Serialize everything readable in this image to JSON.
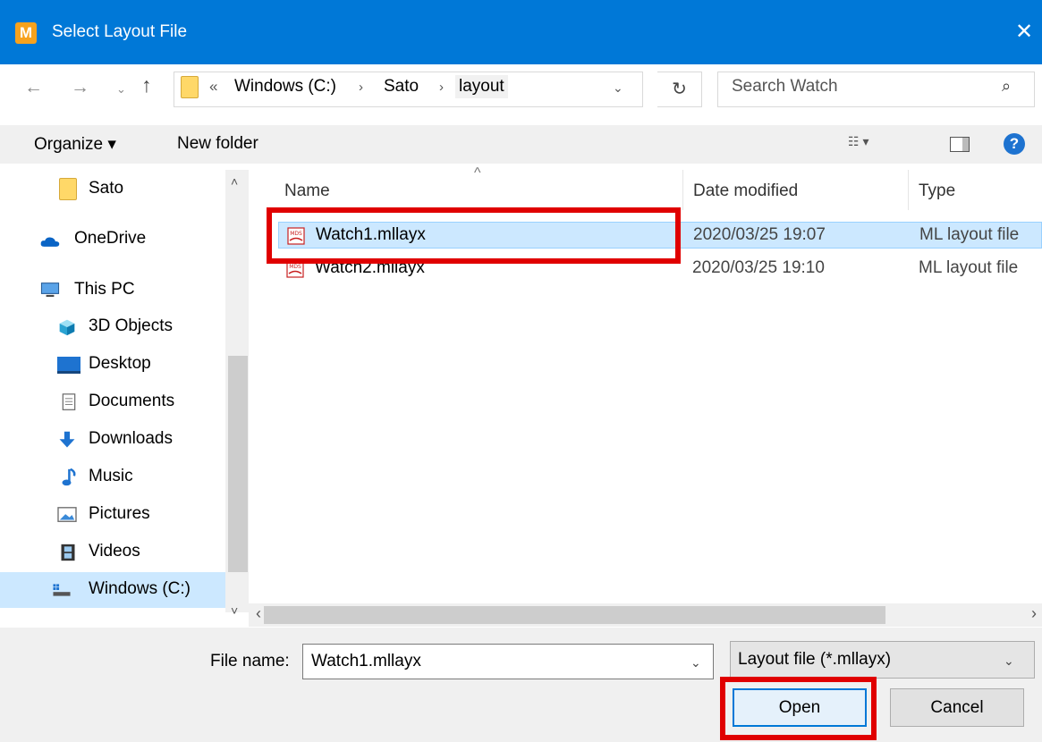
{
  "titlebar": {
    "app_icon": "M",
    "title": "Select Layout File",
    "close": "✕"
  },
  "nav_buttons": {
    "back": "←",
    "forward": "→",
    "recent": "⌄",
    "up": "↑"
  },
  "address": {
    "more": "«",
    "crumbs": [
      "Windows (C:)",
      "Sato",
      "layout"
    ],
    "separator": "›",
    "dropdown": "⌄",
    "refresh": "↻"
  },
  "search": {
    "placeholder": "Search Watch",
    "icon": "⌕"
  },
  "toolbar": {
    "organize": "Organize ▾",
    "new_folder": "New folder",
    "view": "☷ ▾",
    "help": "?"
  },
  "nav_pane": {
    "items": [
      {
        "label": "Sato",
        "icon": "folder-icon"
      },
      {
        "label": "OneDrive",
        "icon": "cloud-icon"
      },
      {
        "label": "This PC",
        "icon": "pc-icon"
      },
      {
        "label": "3D Objects",
        "icon": "cube-icon"
      },
      {
        "label": "Desktop",
        "icon": "desktop-icon"
      },
      {
        "label": "Documents",
        "icon": "document-icon"
      },
      {
        "label": "Downloads",
        "icon": "download-arrow-icon"
      },
      {
        "label": "Music",
        "icon": "music-note-icon"
      },
      {
        "label": "Pictures",
        "icon": "picture-icon"
      },
      {
        "label": "Videos",
        "icon": "film-icon"
      },
      {
        "label": "Windows (C:)",
        "icon": "drive-icon"
      }
    ],
    "selected": "Windows (C:)",
    "scroll_up": "˄",
    "scroll_down": "˅"
  },
  "file_list": {
    "sort_indicator": "^",
    "columns": [
      "Name",
      "Date modified",
      "Type"
    ],
    "rows": [
      {
        "name": "Watch1.mllayx",
        "date": "2020/03/25 19:07",
        "type": "ML layout file",
        "selected": true
      },
      {
        "name": "Watch2.mllayx",
        "date": "2020/03/25 19:10",
        "type": "ML layout file",
        "selected": false
      }
    ],
    "scroll_left": "‹",
    "scroll_right": "›"
  },
  "bottom": {
    "file_name_label": "File name:",
    "file_name_value": "Watch1.mllayx",
    "file_name_dropdown": "⌄",
    "filter_value": "Layout file (*.mllayx)",
    "filter_dropdown": "⌄",
    "open_label": "Open",
    "cancel_label": "Cancel"
  },
  "colors": {
    "accent": "#0078d7",
    "selection": "#cce8ff",
    "highlight": "#e00000",
    "panel": "#f0f0f0"
  }
}
